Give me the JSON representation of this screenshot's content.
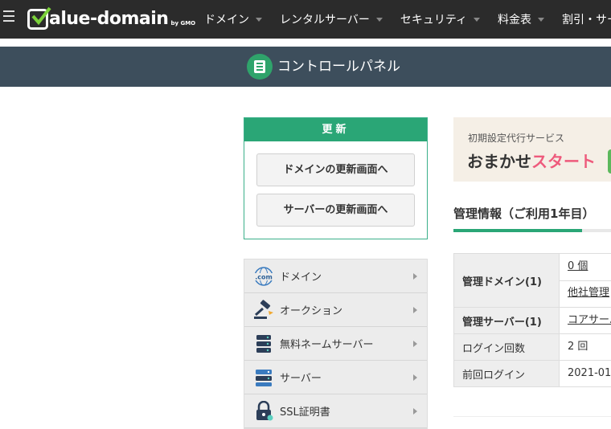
{
  "header": {
    "logo_text": "Value-domain",
    "logo_suffix": "by GMO",
    "nav": [
      {
        "label": "ドメイン"
      },
      {
        "label": "レンタルサーバー"
      },
      {
        "label": "セキュリティ"
      },
      {
        "label": "料金表"
      },
      {
        "label": "割引・サービス"
      }
    ]
  },
  "subheader": {
    "title": "コントロールパネル"
  },
  "renew": {
    "heading": "更新",
    "domain_button": "ドメインの更新画面へ",
    "server_button": "サーバーの更新画面へ"
  },
  "menu": {
    "items": [
      {
        "label": "ドメイン",
        "icon": "com-globe-icon"
      },
      {
        "label": "オークション",
        "icon": "gavel-icon"
      },
      {
        "label": "無料ネームサーバー",
        "icon": "server-stack-icon"
      },
      {
        "label": "サーバー",
        "icon": "server-icon"
      },
      {
        "label": "SSL証明書",
        "icon": "lock-icon"
      }
    ]
  },
  "banner": {
    "subtitle": "初期設定代行サービス",
    "title_plain": "おまかせ",
    "title_accent": "スタート"
  },
  "management": {
    "title": "管理情報（ご利用1年目）",
    "rows": [
      {
        "label": "管理ドメイン(1)",
        "values": [
          "0 個",
          "他社管理"
        ]
      },
      {
        "label": "管理サーバー(1)",
        "values": [
          "コアサーバー"
        ]
      },
      {
        "label": "ログイン回数",
        "values": [
          "2 回"
        ]
      },
      {
        "label": "前回ログイン",
        "values": [
          "2021-01"
        ]
      }
    ]
  },
  "colors": {
    "accent_green": "#2aa676",
    "header_bg": "#2b2b2b",
    "subheader_bg": "#3d4e5c",
    "banner_accent": "#ee5a7c"
  }
}
